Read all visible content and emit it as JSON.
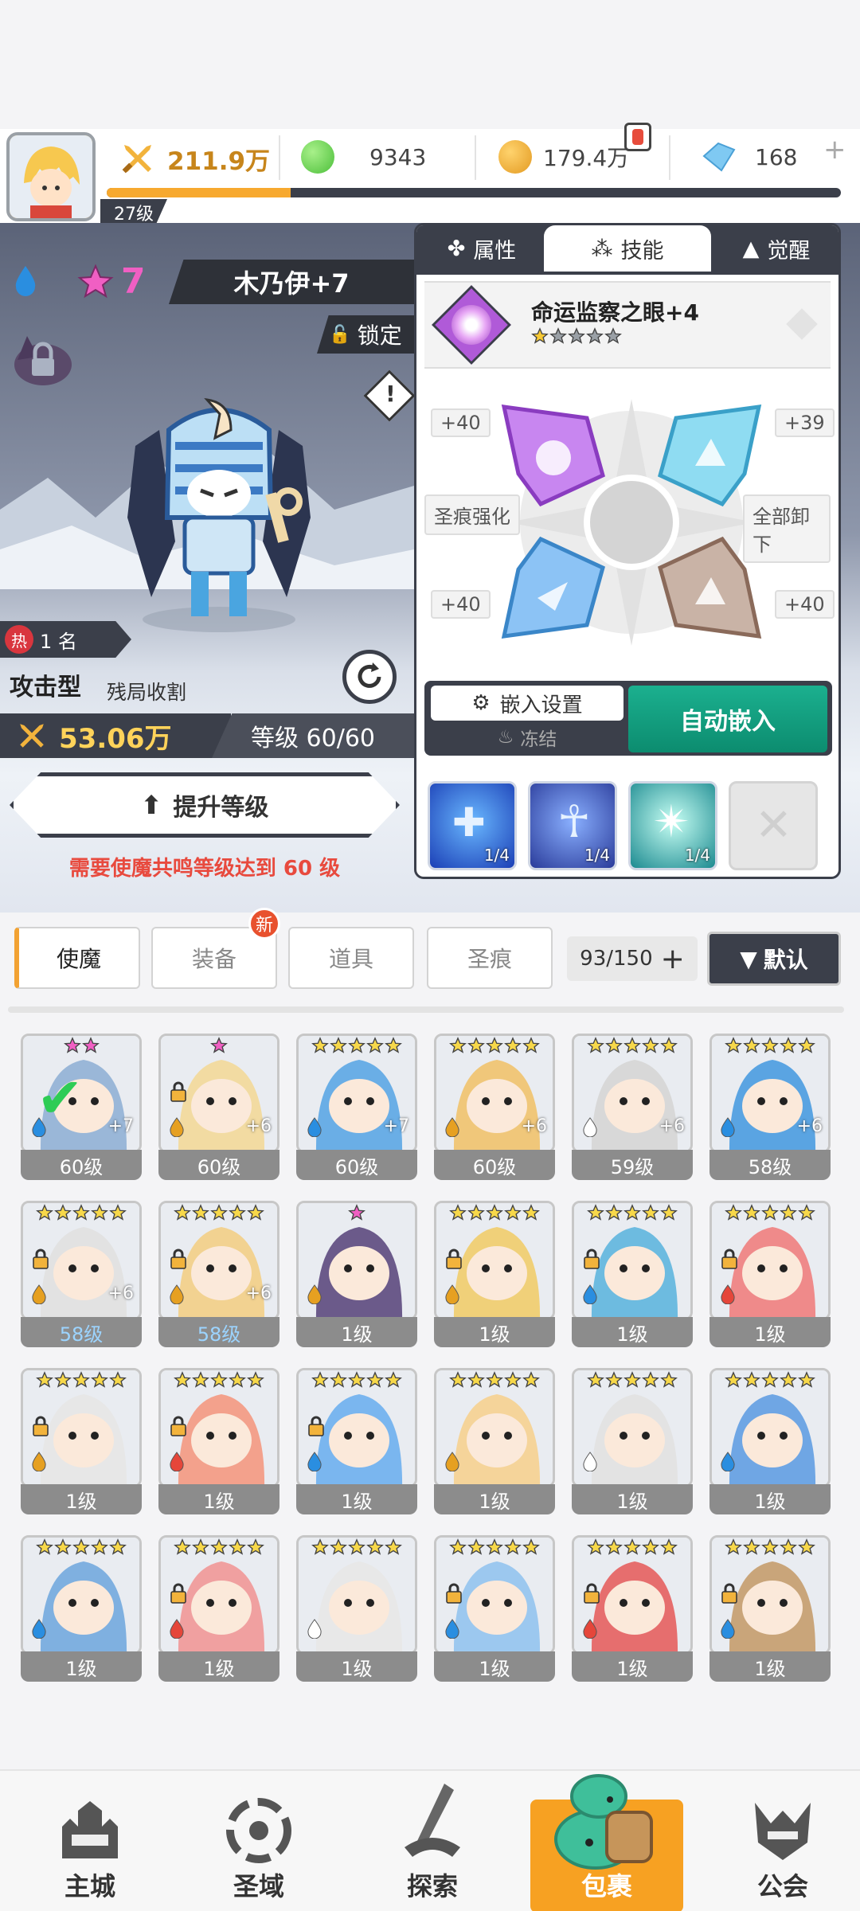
{
  "header": {
    "level": "27级",
    "xp_fraction": 0.25,
    "power": "211.9万",
    "gems": "9343",
    "coins": "179.4万",
    "crystals": "168"
  },
  "hero": {
    "stars": "7",
    "name": "木乃伊+7",
    "lock_label": "锁定",
    "rank": "1 名",
    "type": "攻击型",
    "subtype": "残局收割",
    "power": "53.06万",
    "level_text": "等级 60/60",
    "upgrade_label": "提升等级",
    "requirement": "需要使魔共鸣等级达到 60 级"
  },
  "panel": {
    "tabs": [
      "属性",
      "技能",
      "觉醒"
    ],
    "skill_name": "命运监察之眼+4",
    "skill_stars": 1,
    "sockets": {
      "tl": "+40",
      "tr": "+39",
      "bl": "+40",
      "br": "+40"
    },
    "left_btn": "圣痕强化",
    "right_btn": "全部卸下",
    "embed_settings": "嵌入设置",
    "freeze": "冻结",
    "auto_embed": "自动嵌入",
    "skills": [
      "1/4",
      "1/4",
      "1/4"
    ]
  },
  "inventory": {
    "tabs": [
      "使魔",
      "装备",
      "道具",
      "圣痕"
    ],
    "new_badge": "新",
    "capacity": "93/150",
    "sort": "默认",
    "cards": [
      {
        "level": "60级",
        "plus": "+7",
        "stars": 2,
        "pink": true,
        "color": "#9ab7d8",
        "check": true,
        "elem": "water"
      },
      {
        "level": "60级",
        "plus": "+6",
        "stars": 1,
        "pink": true,
        "color": "#f2dba2",
        "elem": "wind",
        "lock": true
      },
      {
        "level": "60级",
        "plus": "+7",
        "stars": 5,
        "color": "#6aaee6",
        "elem": "water"
      },
      {
        "level": "60级",
        "plus": "+6",
        "stars": 5,
        "color": "#f0c77a",
        "elem": "wind"
      },
      {
        "level": "59级",
        "plus": "+6",
        "stars": 5,
        "color": "#d8d8d8",
        "elem": "light"
      },
      {
        "level": "58级",
        "plus": "+6",
        "stars": 5,
        "color": "#5aa4e2",
        "elem": "water"
      },
      {
        "level": "58级",
        "plus": "+6",
        "stars": 5,
        "color": "#e2e2e2",
        "elem": "wind",
        "lock": true,
        "blue": true
      },
      {
        "level": "58级",
        "plus": "+6",
        "stars": 5,
        "color": "#f2d291",
        "elem": "wind",
        "lock": true,
        "blue": true
      },
      {
        "level": "1级",
        "stars": 1,
        "pink": true,
        "color": "#6b5a8a",
        "elem": "wind"
      },
      {
        "level": "1级",
        "stars": 5,
        "color": "#f0d079",
        "elem": "wind",
        "lock": true
      },
      {
        "level": "1级",
        "stars": 5,
        "color": "#6dbbe0",
        "elem": "water",
        "lock": true
      },
      {
        "level": "1级",
        "stars": 5,
        "color": "#ef8a8a",
        "elem": "fire",
        "lock": true
      },
      {
        "level": "1级",
        "stars": 5,
        "color": "#e7e7e7",
        "elem": "wind",
        "lock": true
      },
      {
        "level": "1级",
        "stars": 5,
        "color": "#f3a18c",
        "elem": "fire",
        "lock": true
      },
      {
        "level": "1级",
        "stars": 5,
        "color": "#7ab6ef",
        "elem": "water",
        "lock": true
      },
      {
        "level": "1级",
        "stars": 5,
        "color": "#f5d49a",
        "elem": "wind"
      },
      {
        "level": "1级",
        "stars": 5,
        "color": "#e3e3e3",
        "elem": "light"
      },
      {
        "level": "1级",
        "stars": 5,
        "color": "#6fa6e4",
        "elem": "water"
      },
      {
        "level": "1级",
        "stars": 5,
        "color": "#7fb0e0",
        "elem": "water"
      },
      {
        "level": "1级",
        "stars": 5,
        "color": "#f0a0a0",
        "elem": "fire",
        "lock": true
      },
      {
        "level": "1级",
        "stars": 5,
        "color": "#e8e8e8",
        "elem": "light"
      },
      {
        "level": "1级",
        "stars": 5,
        "color": "#9cc8ef",
        "elem": "water",
        "lock": true
      },
      {
        "level": "1级",
        "stars": 5,
        "color": "#e66e6e",
        "elem": "fire",
        "lock": true
      },
      {
        "level": "1级",
        "stars": 5,
        "color": "#c9a57a",
        "elem": "water",
        "lock": true
      }
    ]
  },
  "nav": {
    "items": [
      "主城",
      "圣域",
      "探索",
      "包裹",
      "公会"
    ],
    "active": 3
  }
}
